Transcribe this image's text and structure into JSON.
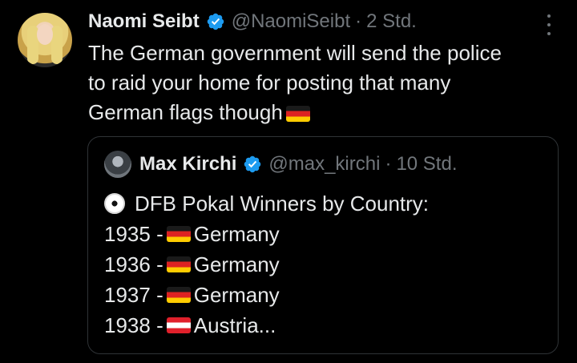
{
  "tweet": {
    "author_name": "Naomi Seibt",
    "handle": "@NaomiSeibt",
    "separator": "·",
    "time": "2 Std.",
    "text_lines": [
      "The German government will send the police",
      "to raid your home for posting that many",
      "German flags though"
    ],
    "icons": {
      "verified": "verified-badge-icon",
      "more": "more-options-icon",
      "flag": "germany-flag-icon"
    }
  },
  "quote": {
    "author_name": "Max Kirchi",
    "handle": "@max_kirchi",
    "separator": "·",
    "time": "10 Std.",
    "heading": "DFB Pokal Winners by Country:",
    "entries": [
      {
        "year": "1935 -",
        "country": "Germany",
        "flag": "germany-flag-icon"
      },
      {
        "year": "1936 -",
        "country": "Germany",
        "flag": "germany-flag-icon"
      },
      {
        "year": "1937 -",
        "country": "Germany",
        "flag": "germany-flag-icon"
      },
      {
        "year": "1938 -",
        "country": "Austria...",
        "flag": "austria-flag-icon"
      }
    ]
  },
  "colors": {
    "background": "#000000",
    "text": "#e7e9ea",
    "muted": "#71767b",
    "verified": "#1d9bf0",
    "border": "#2f3336"
  }
}
